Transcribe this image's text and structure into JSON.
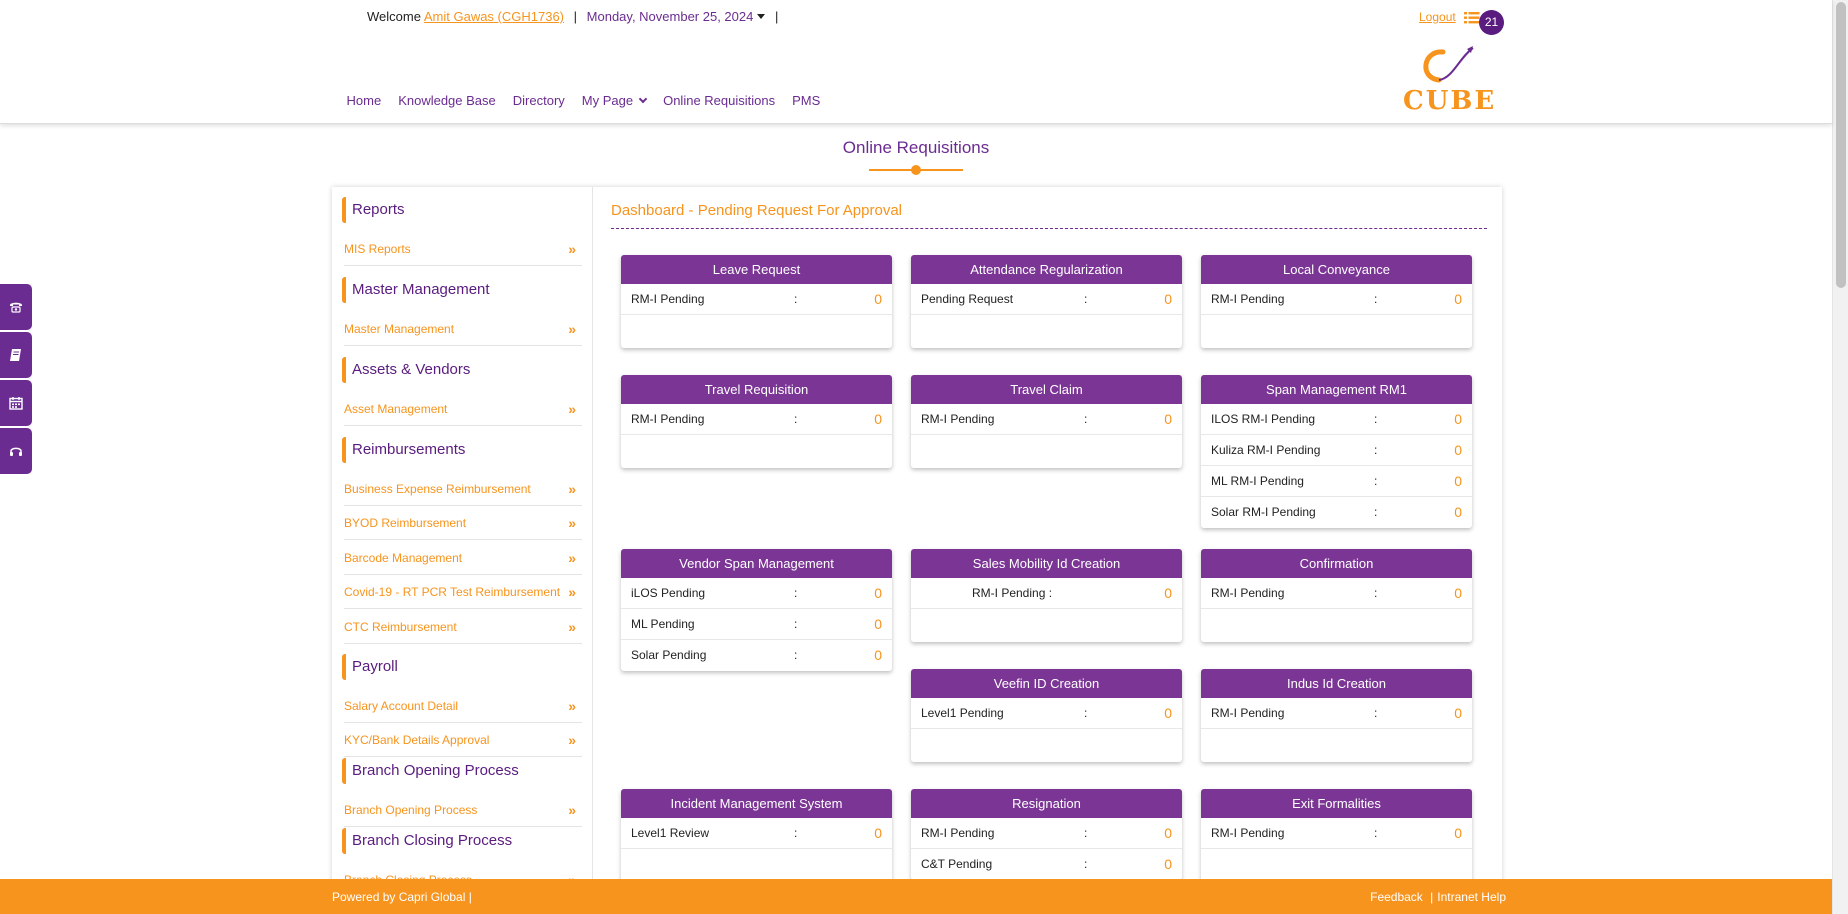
{
  "header": {
    "welcome_label": "Welcome",
    "user_name": "Amit Gawas (CGH1736)",
    "separator": "|",
    "date": "Monday, November 25, 2024",
    "trailing_separator": "|",
    "logout_label": "Logout",
    "notification_count": "21",
    "logo_text": "CUBE"
  },
  "nav": {
    "items": [
      {
        "label": "Home"
      },
      {
        "label": "Knowledge Base"
      },
      {
        "label": "Directory"
      },
      {
        "label": "My Page"
      },
      {
        "label": "Online Requisitions"
      },
      {
        "label": "PMS"
      }
    ]
  },
  "page": {
    "title": "Online Requisitions"
  },
  "sidebar": {
    "sections": [
      {
        "title": "Reports",
        "items": [
          "MIS Reports"
        ]
      },
      {
        "title": "Master Management",
        "items": [
          "Master Management"
        ]
      },
      {
        "title": "Assets & Vendors",
        "items": [
          "Asset Management"
        ]
      },
      {
        "title": "Reimbursements",
        "items": [
          "Business Expense Reimbursement",
          "BYOD Reimbursement",
          "Barcode Management",
          "Covid-19 - RT PCR Test Reimbursement",
          "CTC Reimbursement"
        ]
      },
      {
        "title": "Payroll",
        "items": [
          "Salary Account Detail",
          "KYC/Bank Details Approval"
        ]
      },
      {
        "title": "Branch Opening Process",
        "items": [
          "Branch Opening Process"
        ]
      },
      {
        "title": "Branch Closing Process",
        "items": [
          "Branch Closing Process"
        ]
      }
    ],
    "arrow": "»"
  },
  "dashboard": {
    "title": "Dashboard - Pending Request For Approval",
    "colon": ":",
    "panels": [
      {
        "title": "Leave Request",
        "rows": [
          {
            "label": "RM-I Pending",
            "value": "0"
          }
        ]
      },
      {
        "title": "Attendance Regularization",
        "rows": [
          {
            "label": "Pending Request",
            "value": "0"
          }
        ]
      },
      {
        "title": "Local Conveyance",
        "rows": [
          {
            "label": "RM-I Pending",
            "value": "0"
          }
        ]
      },
      {
        "title": "Travel Requisition",
        "rows": [
          {
            "label": "RM-I Pending",
            "value": "0"
          }
        ]
      },
      {
        "title": "Travel Claim",
        "rows": [
          {
            "label": "RM-I Pending",
            "value": "0"
          }
        ]
      },
      {
        "title": "Span Management RM1",
        "rows": [
          {
            "label": "ILOS RM-I Pending",
            "value": "0"
          },
          {
            "label": "Kuliza RM-I Pending",
            "value": "0"
          },
          {
            "label": "ML RM-I Pending",
            "value": "0"
          },
          {
            "label": "Solar RM-I Pending",
            "value": "0"
          }
        ]
      },
      {
        "title": "Vendor Span Management",
        "rows": [
          {
            "label": "iLOS Pending",
            "value": "0"
          },
          {
            "label": "ML Pending",
            "value": "0"
          },
          {
            "label": "Solar Pending",
            "value": "0"
          }
        ]
      },
      {
        "title": "Sales Mobility Id Creation",
        "rows": [
          {
            "label": "RM-I Pending :",
            "value": "0"
          }
        ]
      },
      {
        "title": "Confirmation",
        "rows": [
          {
            "label": "RM-I Pending",
            "value": "0"
          }
        ]
      },
      {
        "title": "Veefin ID Creation",
        "rows": [
          {
            "label": "Level1 Pending",
            "value": "0"
          }
        ]
      },
      {
        "title": "Indus Id Creation",
        "rows": [
          {
            "label": "RM-I Pending",
            "value": "0"
          }
        ]
      },
      {
        "title": "Incident Management System",
        "rows": [
          {
            "label": "Level1 Review",
            "value": "0"
          }
        ]
      },
      {
        "title": "Resignation",
        "rows": [
          {
            "label": "RM-I Pending",
            "value": "0"
          },
          {
            "label": "C&T Pending",
            "value": "0"
          }
        ]
      },
      {
        "title": "Exit Formalities",
        "rows": [
          {
            "label": "RM-I Pending",
            "value": "0"
          }
        ]
      }
    ]
  },
  "floating_bar": {
    "icons": [
      "phone-icon",
      "book-icon",
      "calendar-icon",
      "headset-icon"
    ]
  },
  "footer": {
    "powered_by": "Powered by Capri Global |",
    "feedback": "Feedback",
    "link_separator": "|",
    "intranet_help": "Intranet Help"
  },
  "colors": {
    "purple": "#6b2c91",
    "panel_header": "#7b3595",
    "orange": "#f7941d"
  }
}
